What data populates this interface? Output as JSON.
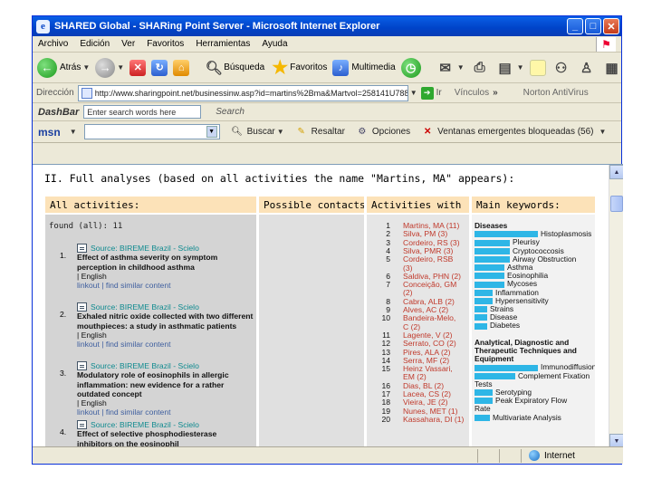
{
  "window": {
    "title": "SHARED Global - SHARing Point Server - Microsoft Internet Explorer"
  },
  "menu": [
    "Archivo",
    "Edición",
    "Ver",
    "Favoritos",
    "Herramientas",
    "Ayuda"
  ],
  "toolbar": {
    "back": "Atrás",
    "search": "Búsqueda",
    "favorites": "Favoritos",
    "multimedia": "Multimedia"
  },
  "address": {
    "label": "Dirección",
    "url": "http://www.sharingpoint.net/businessinw.asp?id=martins%2Bma&Martvol=258141U7885",
    "go": "Ir",
    "links": "Vínculos",
    "norton": "Norton AntiVirus"
  },
  "dashbar": {
    "logo": "DashBar",
    "input": "Enter search words here",
    "search": "Search"
  },
  "msnbar": {
    "logo": "msn",
    "search": "Buscar",
    "highlight": "Resaltar",
    "options": "Opciones",
    "popups": "Ventanas emergentes bloqueadas (56)"
  },
  "page": {
    "heading": "II. Full analyses (based on all activities the name \"Martins, MA\" appears):",
    "headers": {
      "all": "All activities:",
      "contacts": "Possible contacts",
      "with": "Activities with",
      "keywords": "Main keywords:"
    },
    "found": "found (all): 11",
    "results": [
      {
        "num": "1.",
        "source": "Source: BIREME Brazil - Scielo",
        "title": "Effect of asthma severity on symptom perception in childhood asthma",
        "lang": "| English",
        "links": "linkout | find similar content"
      },
      {
        "num": "2.",
        "source": "Source: BIREME Brazil - Scielo",
        "title": "Exhaled nitric oxide collected with two different mouthpieces: a study in asthmatic patients",
        "lang": "| English",
        "links": "linkout | find similar content"
      },
      {
        "num": "3.",
        "source": "Source: BIREME Brazil - Scielo",
        "title": "Modulatory role of eosinophils in allergic inflammation: new evidence for a rather outdated concept",
        "lang": "| English",
        "links": "linkout | find similar content"
      },
      {
        "num": "4.",
        "source": "Source: BIREME Brazil - Scielo",
        "title": "Effect of selective phosphodiesterase inhibitors on the eosinophil",
        "lang": "",
        "links": ""
      }
    ],
    "activities": [
      {
        "n": "1",
        "name": "Martins, MA (11)"
      },
      {
        "n": "2",
        "name": "Silva, PM (3)"
      },
      {
        "n": "3",
        "name": "Cordeiro, RS (3)"
      },
      {
        "n": "4",
        "name": "Silva, PMR (3)"
      },
      {
        "n": "5",
        "name": "Cordeiro, RSB"
      },
      {
        "n": "",
        "name": "(3)"
      },
      {
        "n": "6",
        "name": "Saldiva, PHN (2)"
      },
      {
        "n": "7",
        "name": "Conceição, GM"
      },
      {
        "n": "",
        "name": "(2)"
      },
      {
        "n": "8",
        "name": "Cabra, ALB (2)"
      },
      {
        "n": "9",
        "name": "Alves, AC (2)"
      },
      {
        "n": "10",
        "name": "Bandeira-Melo,"
      },
      {
        "n": "",
        "name": "C (2)"
      },
      {
        "n": "11",
        "name": "Lagente, V (2)"
      },
      {
        "n": "12",
        "name": "Serrato, CO (2)"
      },
      {
        "n": "13",
        "name": "Pires, ALA (2)"
      },
      {
        "n": "14",
        "name": "Serra, MF (2)"
      },
      {
        "n": "15",
        "name": "Heinz Vassari,"
      },
      {
        "n": "",
        "name": "EM (2)"
      },
      {
        "n": "16",
        "name": "Dias, BL (2)"
      },
      {
        "n": "17",
        "name": "Lacea, CS (2)"
      },
      {
        "n": "18",
        "name": "Vieira, JE (2)"
      },
      {
        "n": "19",
        "name": "Nunes, MET (1)"
      },
      {
        "n": "20",
        "name": "Kassahara, DI (1)"
      }
    ],
    "keywords": [
      {
        "cat": true,
        "text": "Diseases"
      },
      {
        "bar": 1.0,
        "text": "Histoplasmosis"
      },
      {
        "bar": 0.5,
        "text": "Pleurisy"
      },
      {
        "bar": 0.5,
        "text": "Cryptococcosis"
      },
      {
        "bar": 0.5,
        "text": "Airway Obstruction"
      },
      {
        "bar": 0.4,
        "text": "Asthma"
      },
      {
        "bar": 0.4,
        "text": "Eosinophilia"
      },
      {
        "bar": 0.4,
        "text": "Mycoses"
      },
      {
        "bar": 0.2,
        "text": "Inflammation"
      },
      {
        "bar": 0.2,
        "text": "Hypersensitivity"
      },
      {
        "bar": 0.1,
        "text": "Strains"
      },
      {
        "bar": 0.1,
        "text": "Disease"
      },
      {
        "bar": 0.1,
        "text": "Diabetes"
      },
      {
        "gap": true
      },
      {
        "cat": true,
        "text": "Analytical, Diagnostic and"
      },
      {
        "cat": true,
        "text": "Therapeutic Techniques and"
      },
      {
        "cat": true,
        "text": "Equipment"
      },
      {
        "bar": 1.0,
        "text": "Immunodiffusion"
      },
      {
        "bar": 0.6,
        "text": "Complement Fixation"
      },
      {
        "plain": true,
        "text": "Tests"
      },
      {
        "bar": 0.2,
        "text": "Serotyping"
      },
      {
        "bar": 0.2,
        "text": "Peak Expiratory Flow"
      },
      {
        "plain": true,
        "text": "Rate"
      },
      {
        "bar": 0.15,
        "text": "Multivariate Analysis"
      }
    ]
  },
  "status": {
    "zone": "Internet"
  }
}
